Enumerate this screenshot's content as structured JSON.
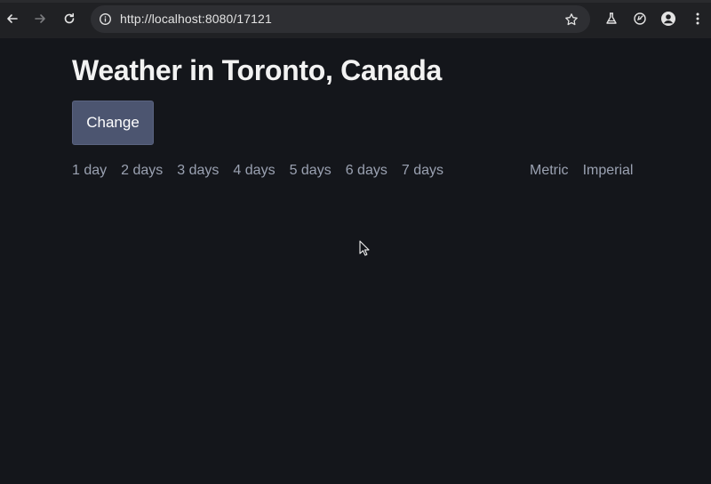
{
  "browser": {
    "url": "http://localhost:8080/17121",
    "icons": {
      "back": "back-arrow-icon",
      "forward": "forward-arrow-icon",
      "reload": "reload-icon",
      "site_info": "info-icon",
      "bookmark": "star-icon",
      "labs": "flask-icon",
      "extension": "gauge-icon",
      "profile": "profile-icon",
      "menu": "kebab-menu-icon"
    }
  },
  "page": {
    "title": "Weather in Toronto, Canada",
    "change_label": "Change",
    "day_options": [
      "1 day",
      "2 days",
      "3 days",
      "4 days",
      "5 days",
      "6 days",
      "7 days"
    ],
    "unit_options": [
      "Metric",
      "Imperial"
    ]
  },
  "colors": {
    "background": "#14161b",
    "button": "#4c5570",
    "link": "#9aa1b1",
    "title": "#f2f2f2"
  }
}
